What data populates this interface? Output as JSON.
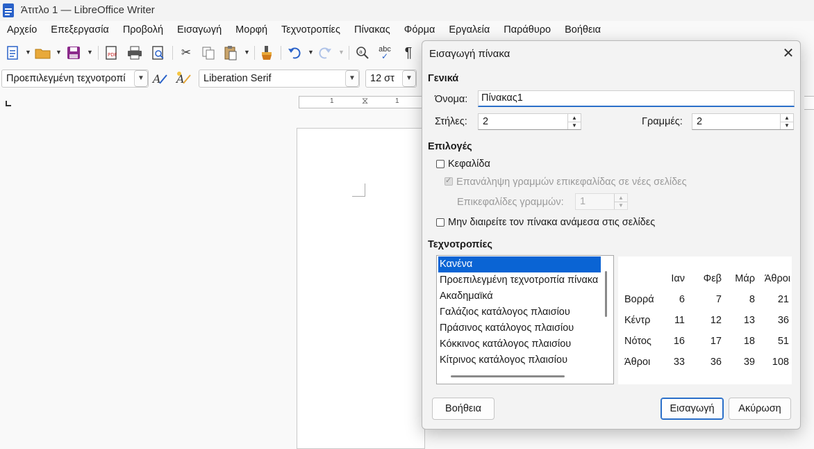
{
  "window": {
    "title": "Άτιτλο 1 — LibreOffice Writer"
  },
  "menubar": [
    "Αρχείο",
    "Επεξεργασία",
    "Προβολή",
    "Εισαγωγή",
    "Μορφή",
    "Τεχνοτροπίες",
    "Πίνακας",
    "Φόρμα",
    "Εργαλεία",
    "Παράθυρο",
    "Βοήθεια"
  ],
  "toolbar": {
    "paragraph_style": "Προεπιλεγμένη τεχνοτροπί",
    "font_name": "Liberation Serif",
    "font_size": "12 στ",
    "pilcrow": "¶",
    "spellcheck": "abc",
    "ruler_labels": [
      "1",
      "1"
    ]
  },
  "dialog": {
    "title": "Εισαγωγή πίνακα",
    "general_heading": "Γενικά",
    "name_label": "Όνομα:",
    "name_value": "Πίνακας1",
    "columns_label": "Στήλες:",
    "columns_value": "2",
    "rows_label": "Γραμμές:",
    "rows_value": "2",
    "options_heading": "Επιλογές",
    "heading_label": "Κεφαλίδα",
    "repeat_heading_label": "Επανάληψη γραμμών επικεφαλίδας σε νέες σελίδες",
    "heading_rows_label": "Επικεφαλίδες γραμμών:",
    "heading_rows_value": "1",
    "dont_split_label": "Μην διαιρείτε τον πίνακα ανάμεσα στις σελίδες",
    "styles_heading": "Τεχνοτροπίες",
    "styles": [
      "Κανένα",
      "Προεπιλεγμένη τεχνοτροπία πίνακα",
      "Ακαδημαϊκά",
      "Γαλάζιος κατάλογος πλαισίου",
      "Πράσινος κατάλογος πλαισίου",
      "Κόκκινος κατάλογος πλαισίου",
      "Κίτρινος κατάλογος πλαισίου"
    ],
    "preview": {
      "columns": [
        "Ιαν",
        "Φεβ",
        "Μάρ",
        "Άθροι"
      ],
      "rows": [
        {
          "label": "Βορρά",
          "values": [
            "6",
            "7",
            "8",
            "21"
          ]
        },
        {
          "label": "Κέντρ",
          "values": [
            "11",
            "12",
            "13",
            "36"
          ]
        },
        {
          "label": "Νότος",
          "values": [
            "16",
            "17",
            "18",
            "51"
          ]
        },
        {
          "label": "Άθροι",
          "values": [
            "33",
            "36",
            "39",
            "108"
          ]
        }
      ]
    },
    "help_button": "Βοήθεια",
    "insert_button": "Εισαγωγή",
    "cancel_button": "Ακύρωση"
  },
  "colors": {
    "selection": "#0a64d4",
    "accent": "#2a6fc9"
  }
}
